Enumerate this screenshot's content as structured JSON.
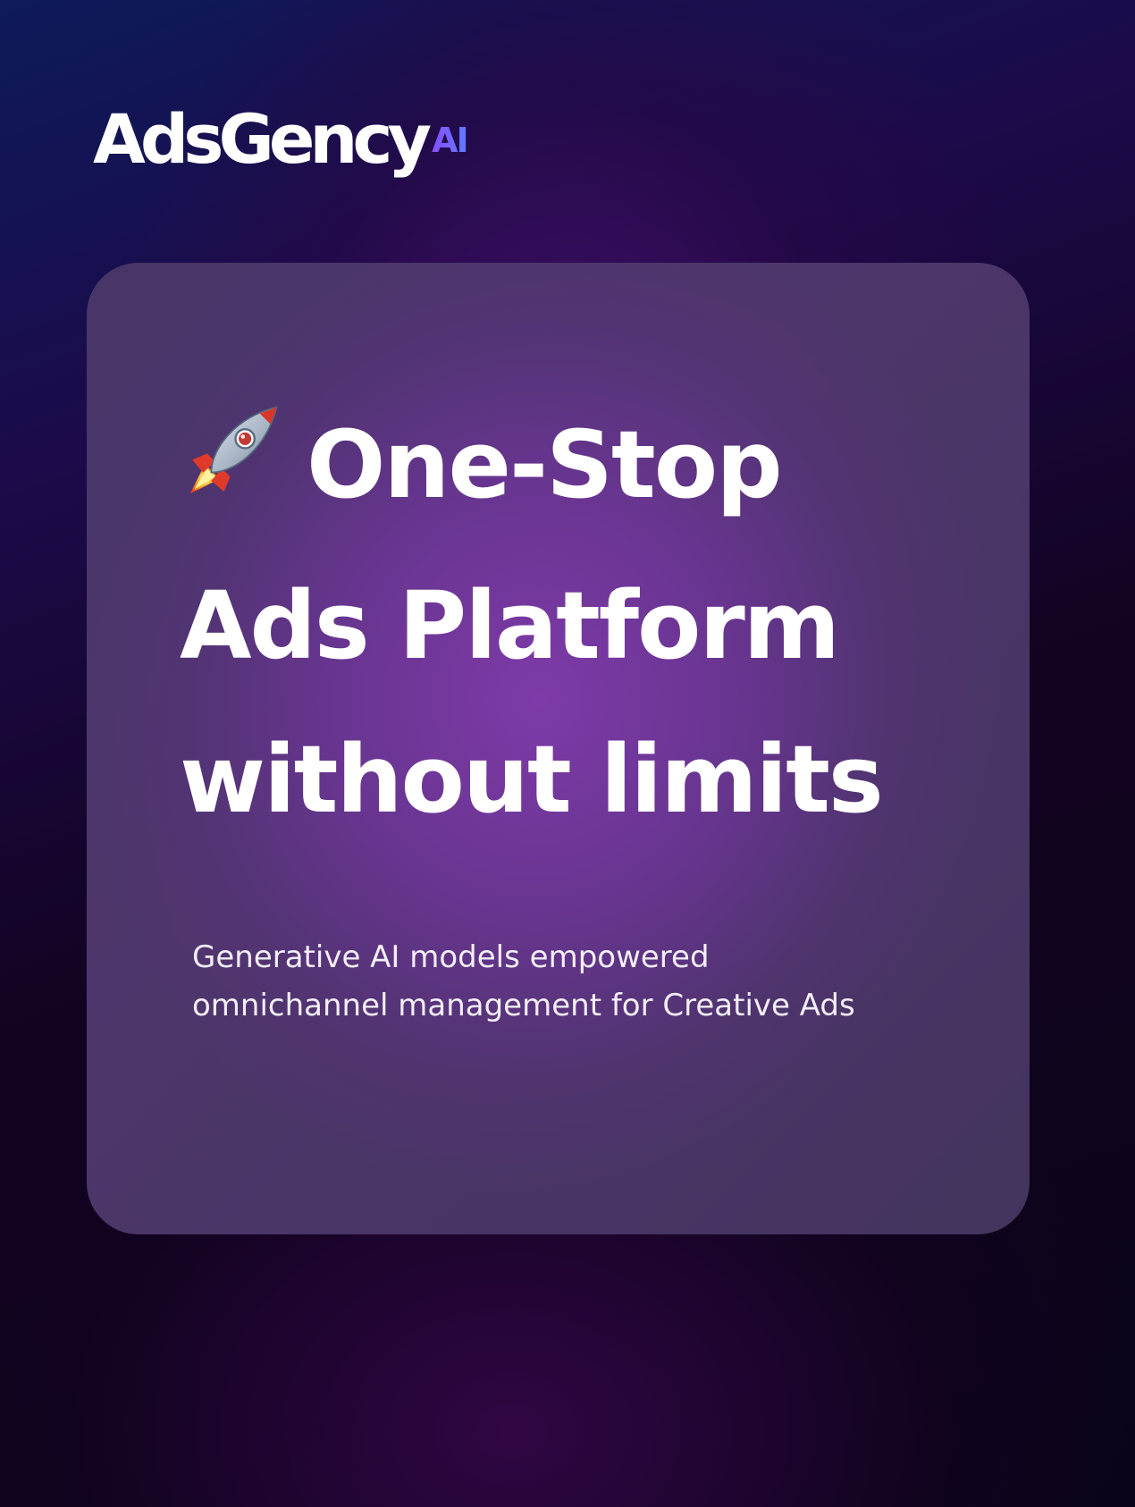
{
  "brand": {
    "logo_text": "AdsGency",
    "logo_suffix": "AI"
  },
  "hero": {
    "rocket_icon": "rocket-icon",
    "headline_lines": [
      "One-Stop",
      "Ads Platform",
      "without limits"
    ],
    "subtitle_lines": [
      "Generative AI models empowered",
      "omnichannel management for Creative Ads"
    ]
  },
  "colors": {
    "background_dark": "#0a0418",
    "background_blue": "#0e1a5a",
    "card_purple": "#7a37a8",
    "text_white": "#ffffff",
    "ai_gradient_start": "#8a4dff",
    "ai_gradient_end": "#5d7bff"
  }
}
